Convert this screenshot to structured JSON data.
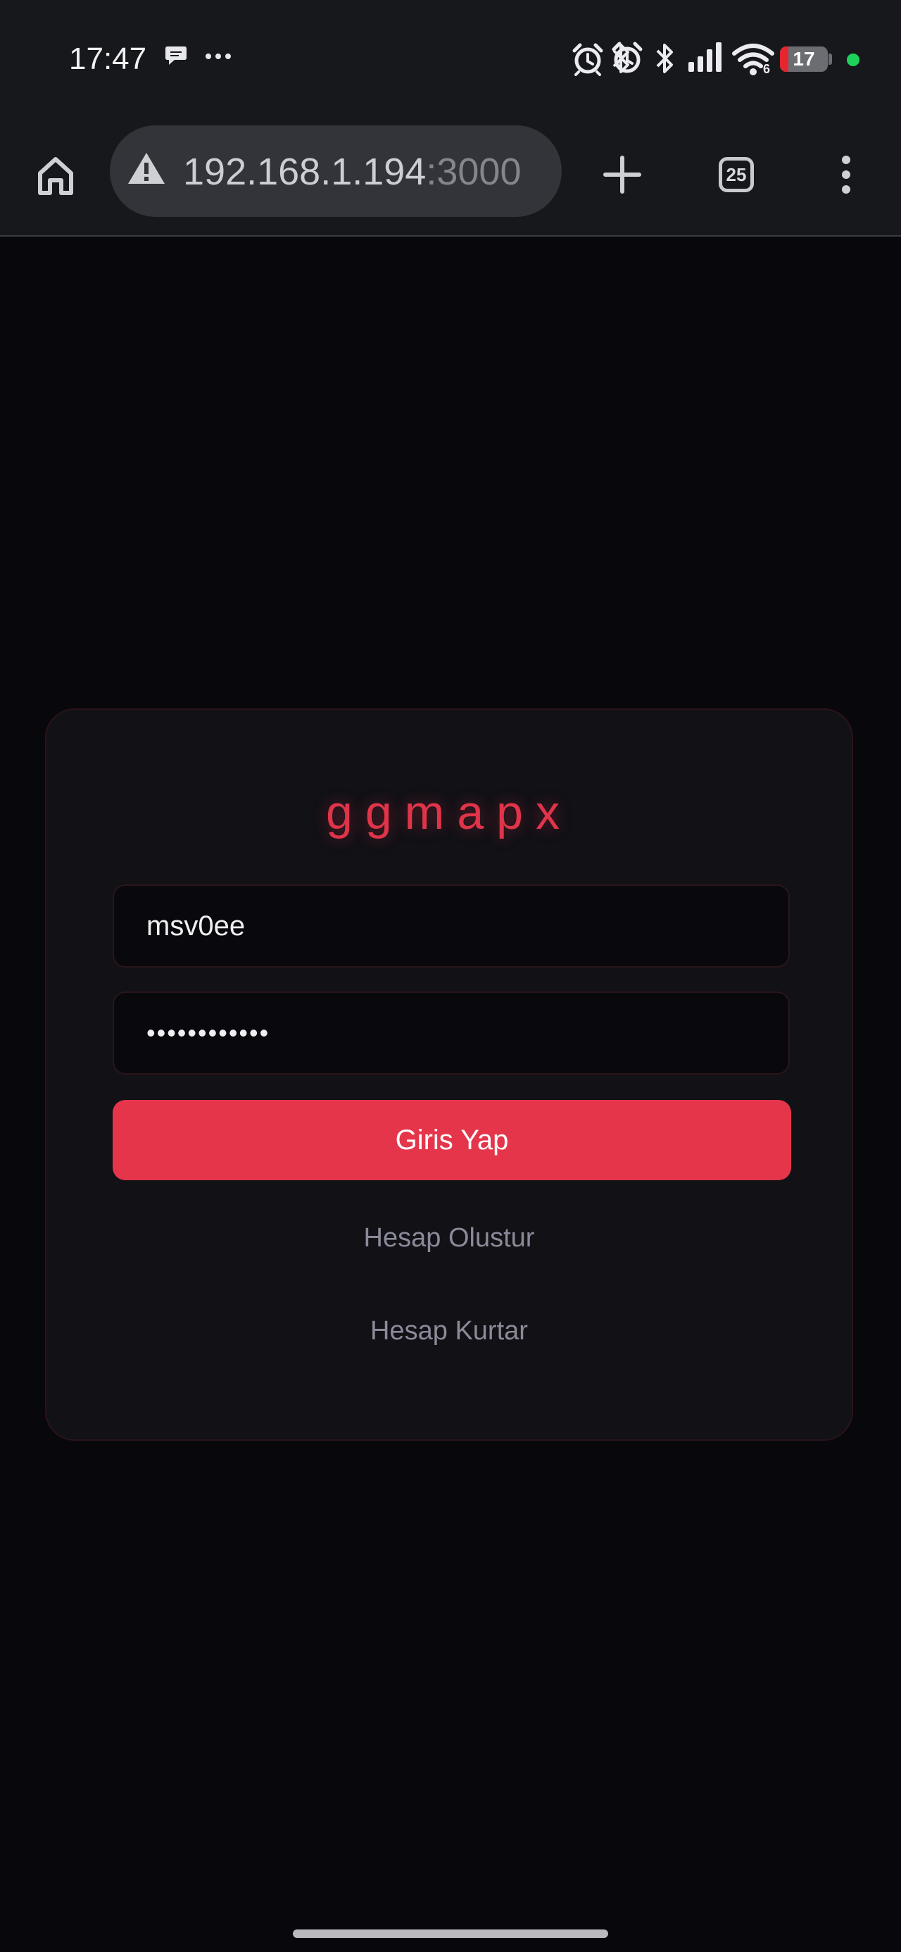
{
  "status_bar": {
    "time": "17:47",
    "battery_level": "17",
    "icons": [
      "chat-bubble-icon",
      "more-dots-icon",
      "alarm-icon",
      "bluetooth-icon",
      "signal-icon",
      "wifi-icon",
      "battery-icon"
    ],
    "wifi_badge": "6",
    "indicator_color": "#1ed15b"
  },
  "browser": {
    "url_host": "192.168.1.194",
    "url_port": ":3000",
    "tab_count": "25",
    "icons": [
      "home-icon",
      "warning-icon",
      "plus-icon",
      "tabs-icon",
      "menu-icon"
    ]
  },
  "login": {
    "brand": "ggmapx",
    "username_value": "msv0ee",
    "password_value": "••••••••••••",
    "submit_label": "Giris Yap",
    "create_account_label": "Hesap Olustur",
    "recover_account_label": "Hesap Kurtar",
    "accent_color": "#e5354b"
  }
}
